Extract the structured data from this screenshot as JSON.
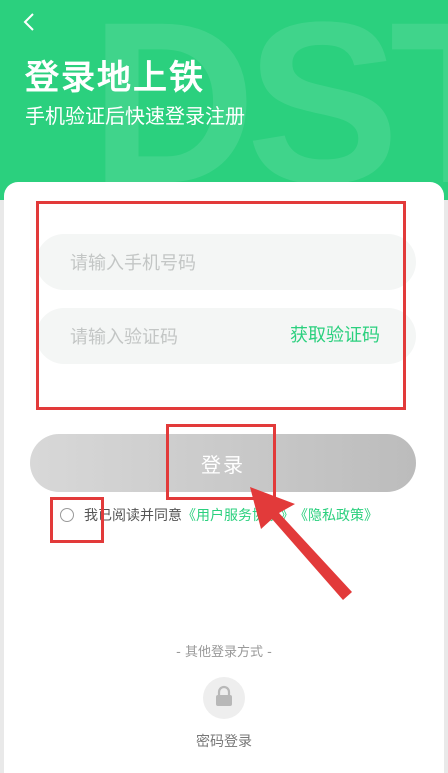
{
  "header": {
    "back_icon": "chevron-left-icon",
    "title": "登录地上铁",
    "subtitle": "手机验证后快速登录注册",
    "watermark": "DST",
    "color": "#2bd07e"
  },
  "form": {
    "phone_placeholder": "请输入手机号码",
    "code_placeholder": "请输入验证码",
    "get_code_label": "获取验证码",
    "login_label": "登录"
  },
  "agreement": {
    "prefix": "我已阅读并同意",
    "user_agreement": "《用户服务协议》",
    "privacy_policy": "《隐私政策》"
  },
  "other_login": {
    "label": "- 其他登录方式 -",
    "password_login_label": "密码登录",
    "password_icon": "lock-icon"
  },
  "annotations": {
    "highlight_color": "#e23a3a",
    "highlight_icon": "arrow-icon"
  }
}
